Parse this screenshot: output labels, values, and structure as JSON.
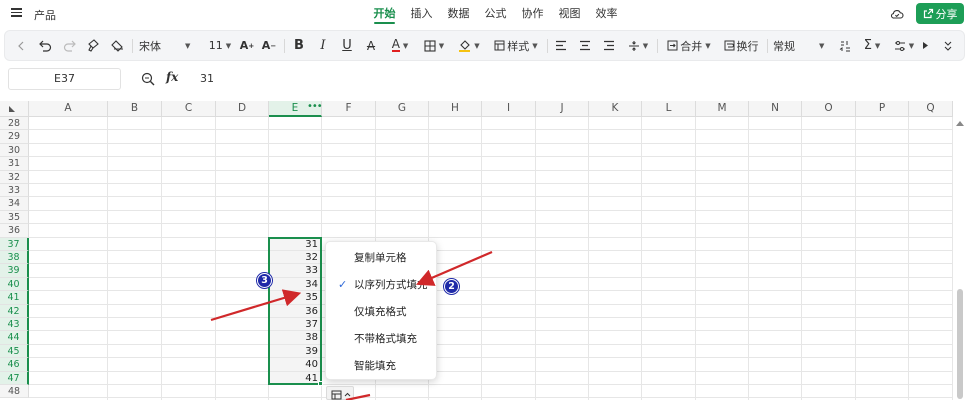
{
  "app": {
    "doc_title": "产品",
    "tabs": [
      "开始",
      "插入",
      "数据",
      "公式",
      "协作",
      "视图",
      "效率"
    ],
    "active_tab": "开始",
    "share_label": "分享",
    "accent": "#1a8f4d",
    "share_color": "#1d9e57"
  },
  "toolbar": {
    "font_name": "宋体",
    "font_size": "11",
    "style_label": "样式",
    "merge_label": "合并",
    "wrap_label": "换行",
    "format_label": "常规",
    "icons": [
      "back-icon",
      "undo-icon",
      "redo-icon",
      "format-painter-icon",
      "clear-format-icon",
      "increase-font-icon",
      "decrease-font-icon",
      "bold-icon",
      "italic-icon",
      "underline-icon",
      "strikethrough-icon",
      "font-color-icon",
      "borders-icon",
      "fill-color-icon",
      "styles-icon",
      "align-left-icon",
      "align-center-icon",
      "vertical-align-icon",
      "merge-icon",
      "wrap-icon",
      "decimal-icon",
      "sum-icon",
      "more-icon",
      "expand-icon"
    ]
  },
  "formula_bar": {
    "cell_ref": "E37",
    "fx_label": "fx",
    "value": "31"
  },
  "grid": {
    "columns": [
      "A",
      "B",
      "C",
      "D",
      "E",
      "F",
      "G",
      "H",
      "I",
      "J",
      "K",
      "L",
      "M",
      "N",
      "O",
      "P",
      "Q"
    ],
    "selected_column": "E",
    "rows": [
      "28",
      "29",
      "30",
      "31",
      "32",
      "33",
      "34",
      "35",
      "36",
      "37",
      "38",
      "39",
      "40",
      "41",
      "42",
      "43",
      "44",
      "45",
      "46",
      "47",
      "48"
    ],
    "selected_rows": [
      "37",
      "38",
      "39",
      "40",
      "41",
      "42",
      "43",
      "44",
      "45",
      "46",
      "47"
    ],
    "column_e_values": [
      "31",
      "32",
      "33",
      "34",
      "35",
      "36",
      "37",
      "38",
      "39",
      "40",
      "41"
    ]
  },
  "autofill_menu": {
    "items": [
      "复制单元格",
      "以序列方式填充",
      "仅填充格式",
      "不带格式填充",
      "智能填充"
    ],
    "checked_item": "以序列方式填充",
    "check_color": "#2d68d8"
  },
  "annotations": {
    "badges": [
      "3",
      "2"
    ],
    "arrow_color": "#d0282a",
    "badge_color": "#1f2aa8"
  }
}
